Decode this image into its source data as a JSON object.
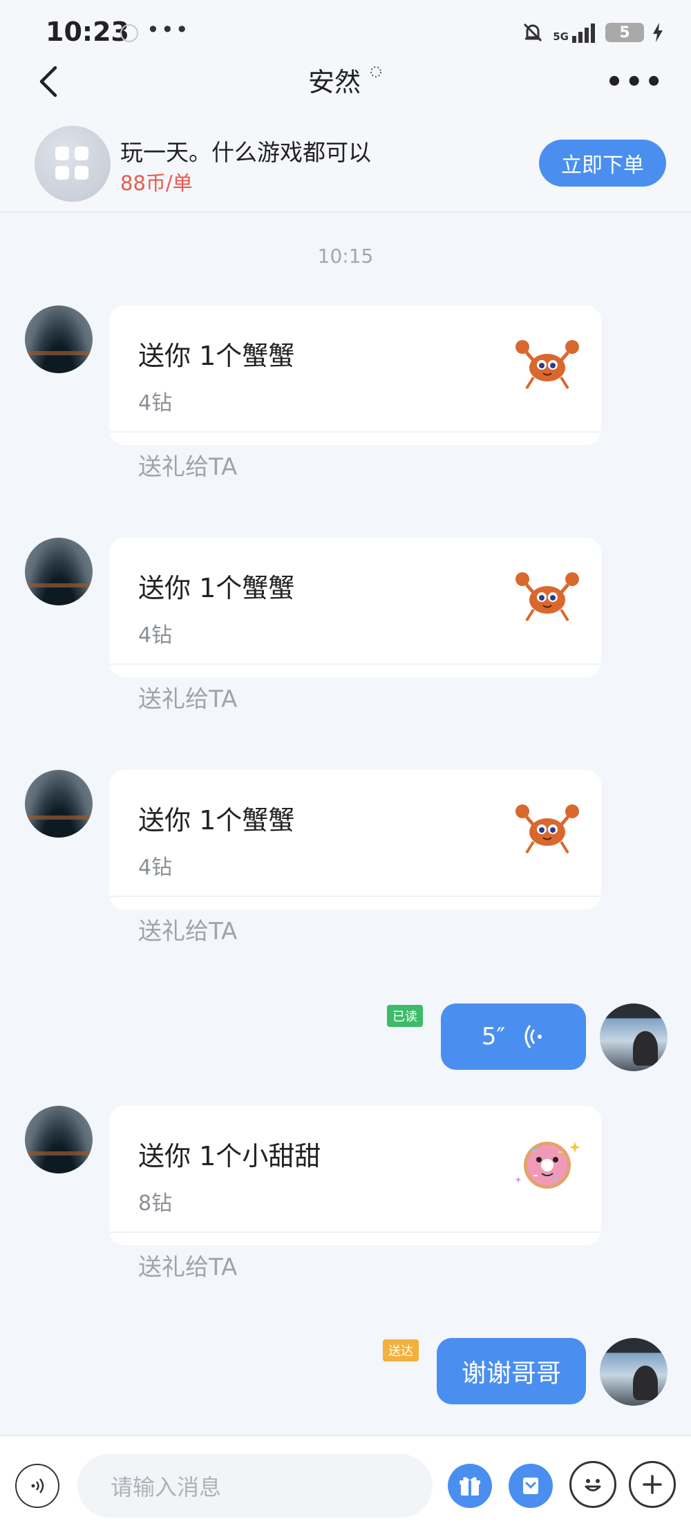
{
  "status_bar": {
    "time": "10:23",
    "dots": "•••",
    "network": "5G",
    "battery": "5"
  },
  "header": {
    "title": "安然",
    "back_icon": "chevron-left-icon",
    "more_icon": "more-horizontal-icon"
  },
  "order_banner": {
    "title": "玩一天。什么游戏都可以",
    "price": "88币/单",
    "button": "立即下单"
  },
  "timestamp": "10:15",
  "messages": [
    {
      "type": "gift",
      "from": "other",
      "text": "送你 1个蟹蟹",
      "cost": "4钻",
      "action": "送礼给TA",
      "gift_icon": "crab-icon"
    },
    {
      "type": "gift",
      "from": "other",
      "text": "送你 1个蟹蟹",
      "cost": "4钻",
      "action": "送礼给TA",
      "gift_icon": "crab-icon"
    },
    {
      "type": "gift",
      "from": "other",
      "text": "送你 1个蟹蟹",
      "cost": "4钻",
      "action": "送礼给TA",
      "gift_icon": "crab-icon"
    },
    {
      "type": "voice",
      "from": "me",
      "duration": "5″",
      "status": "已读",
      "status_color": "#3dbb6a"
    },
    {
      "type": "gift",
      "from": "other",
      "text": "送你 1个小甜甜",
      "cost": "8钻",
      "action": "送礼给TA",
      "gift_icon": "donut-icon"
    },
    {
      "type": "text",
      "from": "me",
      "text": "谢谢哥哥",
      "status": "送达",
      "status_color": "#f2b13c"
    }
  ],
  "input_bar": {
    "placeholder": "请输入消息"
  },
  "colors": {
    "accent": "#4a8fef",
    "price": "#e85a4f",
    "background": "#f3f6fa"
  }
}
